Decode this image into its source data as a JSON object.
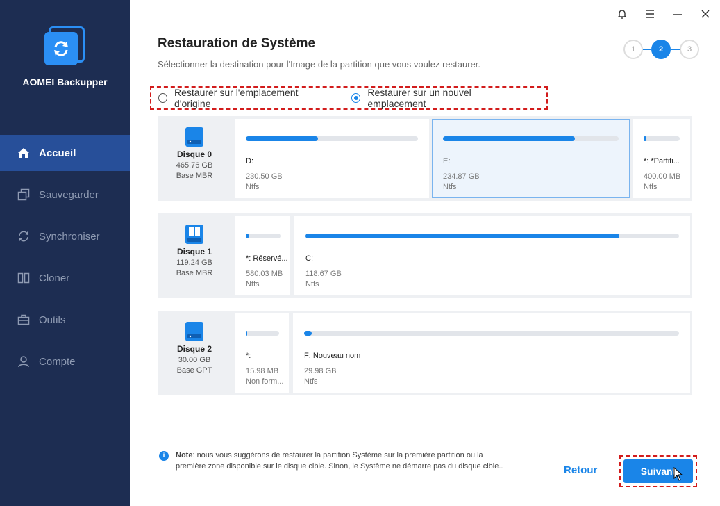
{
  "app": {
    "name": "AOMEI Backupper"
  },
  "sidebar": {
    "items": [
      {
        "label": "Accueil",
        "icon": "home-icon",
        "active": true
      },
      {
        "label": "Sauvegarder",
        "icon": "backup-icon"
      },
      {
        "label": "Synchroniser",
        "icon": "sync-icon"
      },
      {
        "label": "Cloner",
        "icon": "clone-icon"
      },
      {
        "label": "Outils",
        "icon": "toolbox-icon"
      },
      {
        "label": "Compte",
        "icon": "user-icon"
      }
    ]
  },
  "header": {
    "title": "Restauration de Système",
    "subtitle": "Sélectionner la destination pour l'Image de la partition que vous voulez restaurer."
  },
  "steps": {
    "labels": [
      "1",
      "2",
      "3"
    ],
    "current": 2
  },
  "options": {
    "original": "Restaurer sur l'emplacement d'origine",
    "new": "Restaurer sur un nouvel emplacement",
    "selected": "new"
  },
  "disks": [
    {
      "name": "Disque 0",
      "size": "465.76 GB",
      "type": "Base MBR",
      "partitions": [
        {
          "name": "D:",
          "size": "230.50 GB",
          "fs": "Ntfs",
          "used": 0.42
        },
        {
          "name": "E:",
          "size": "234.87 GB",
          "fs": "Ntfs",
          "used": 0.75,
          "selected": true
        },
        {
          "name": "*: *Partiti...",
          "size": "400.00 MB",
          "fs": "Ntfs",
          "used": 0.08
        }
      ]
    },
    {
      "name": "Disque 1",
      "size": "119.24 GB",
      "type": "Base MBR",
      "partitions": [
        {
          "name": "*: Réservé...",
          "size": "580.03 MB",
          "fs": "Ntfs",
          "used": 0.08
        },
        {
          "name": "C:",
          "size": "118.67 GB",
          "fs": "Ntfs",
          "used": 0.84
        }
      ]
    },
    {
      "name": "Disque 2",
      "size": "30.00 GB",
      "type": "Base GPT",
      "partitions": [
        {
          "name": "*:",
          "size": "15.98 MB",
          "fs": "Non form...",
          "used": 0.05
        },
        {
          "name": "F: Nouveau nom",
          "size": "29.98 GB",
          "fs": "Ntfs",
          "used": 0.02
        }
      ]
    }
  ],
  "note": {
    "label": "Note",
    "text": ": nous vous suggérons de restaurer la partition Système sur la première partition ou la première zone disponible sur le disque cible. Sinon, le Système ne démarre pas du disque cible.."
  },
  "buttons": {
    "back": "Retour",
    "next": "Suivant"
  },
  "colors": {
    "accent": "#1a85e8",
    "sidebar": "#1d2d52",
    "highlight": "#d21c1c"
  }
}
